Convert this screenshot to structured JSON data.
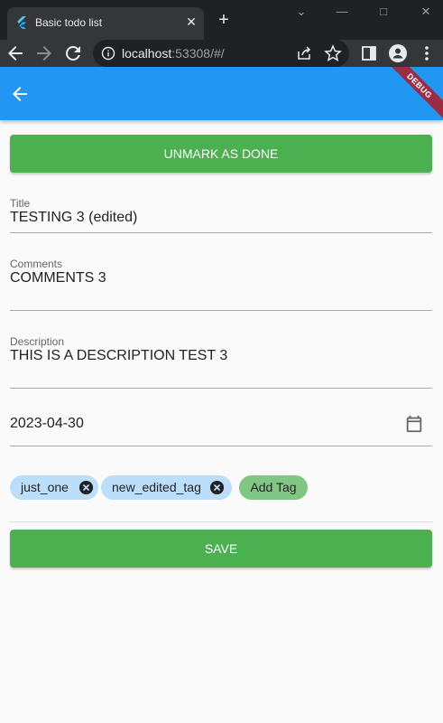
{
  "browser": {
    "tab_title": "Basic todo list",
    "tab_close": "✕",
    "new_tab": "+",
    "url_host": "localhost",
    "url_rest": ":53308/#/"
  },
  "appbar": {
    "debug_banner": "DEBUG",
    "color": "#2196f3"
  },
  "form": {
    "unmark_button": "UNMARK AS DONE",
    "title_label": "Title",
    "title_value": "TESTING 3 (edited)",
    "comments_label": "Comments",
    "comments_value": "COMMENTS 3",
    "description_label": "Description",
    "description_value": "THIS IS A DESCRIPTION TEST 3",
    "date_value": "2023-04-30",
    "tags": [
      {
        "label": "just_one"
      },
      {
        "label": "new_edited_tag"
      }
    ],
    "add_tag_label": "Add Tag",
    "save_button": "SAVE",
    "button_color": "#4caf50",
    "chip_color": "#bbdefb",
    "add_tag_color": "#81c784"
  },
  "icons": {
    "favicon": "flutter-icon",
    "back": "arrow-back-icon",
    "forward": "arrow-forward-icon",
    "reload": "reload-icon",
    "info": "info-icon",
    "share": "share-icon",
    "star": "star-icon",
    "sidepanel": "side-panel-icon",
    "profile": "profile-icon",
    "menu": "kebab-menu-icon",
    "calendar": "calendar-icon",
    "chip_delete": "cancel-circle-icon"
  }
}
